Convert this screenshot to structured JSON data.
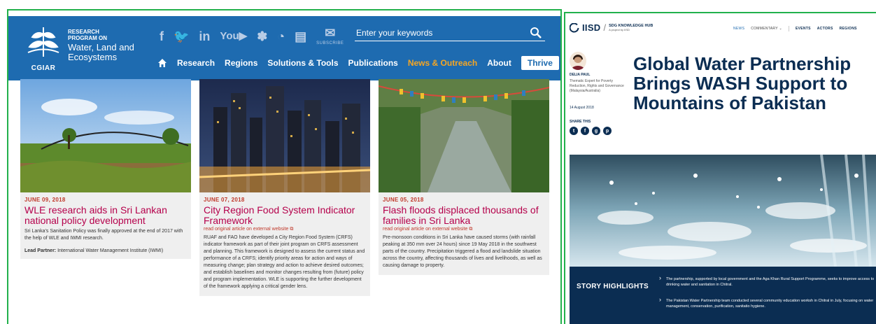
{
  "wle": {
    "program_small": "RESEARCH PROGRAM ON",
    "program_big": "Water, Land and Ecosystems",
    "cgiar": "CGIAR",
    "subscribe": "SUBSCRIBE",
    "search_placeholder": "Enter your keywords",
    "nav": [
      "Research",
      "Regions",
      "Solutions & Tools",
      "Publications",
      "News & Outreach",
      "About"
    ],
    "thrive": "Thrive",
    "cards": [
      {
        "date": "JUNE 09, 2018",
        "title": "WLE research aids in Sri Lankan national policy development",
        "ext": "",
        "text": "Sri Lanka's Sanitation Policy was finally approved at the end of 2017 with the help of WLE and IWMI research.",
        "lead_label": "Lead Partner:",
        "lead_value": "International Water Management Institute (IWMI)"
      },
      {
        "date": "JUNE 07, 2018",
        "title": "City Region Food System Indicator Framework",
        "ext": "read original article on external website",
        "text": "RUAF and FAO have developed a City Region Food System (CRFS) indicator framework as part of their joint program on CRFS assessment and planning. This framework is designed to assess the current status and performance of a CRFS; identify priority areas for action and ways of measuring change; plan strategy and action to achieve desired outcomes; and establish baselines and monitor changes resulting from (future) policy and program implementation. WLE is supporting the further development of the framework applying a critical gender lens.",
        "lead_label": "",
        "lead_value": ""
      },
      {
        "date": "JUNE 05, 2018",
        "title": "Flash floods displaced thousands of families in Sri Lanka",
        "ext": "read original article on external website",
        "text": "Pre-monsoon conditions in Sri Lanka have caused storms (with rainfall peaking at 350 mm over 24 hours) since 19 May 2018 in the southwest parts of the country. Precipitation triggered a flood and landslide situation across the country, affecting thousands of lives and livelihoods, as well as causing damage to property.",
        "lead_label": "",
        "lead_value": ""
      }
    ]
  },
  "iisd": {
    "brand": "IISD",
    "hub_title": "SDG KNOWLEDGE HUB",
    "hub_sub": "A project by IISD",
    "nav": [
      "NEWS",
      "COMMENTARY ⌄",
      "EVENTS",
      "ACTORS",
      "REGIONS"
    ],
    "author_name": "DELIA PAUL",
    "author_role": "Thematic Expert for Poverty Reduction, Rights and Governance (Malaysia/Australia)",
    "date": "14 August 2018",
    "share_label": "SHARE THIS",
    "article_title": "Global Water Partnership Brings WASH Support to Mountains of Pakistan",
    "highlights_label": "STORY HIGHLIGHTS",
    "highlights": [
      "The partnership, supported by local government and the Aga Khan Rural Support Programme, seeks to improve access to drinking water and sanitation in Chitral.",
      "The Pakistan Water Partnership team conducted several community education worksh in Chitral in July, focusing on water management, conservation, purification, sanitatio hygiene."
    ]
  },
  "colors": {
    "wle_blue": "#1e6bb0",
    "wle_accent": "#f5a623",
    "card_title": "#b5004b",
    "iisd_navy": "#0b2d52",
    "frame": "#22b14c"
  }
}
